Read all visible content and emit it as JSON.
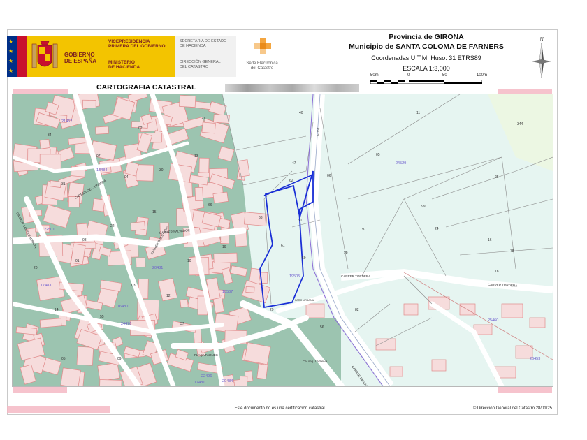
{
  "header": {
    "gov_line1": "GOBIERNO",
    "gov_line2": "DE ESPAÑA",
    "vice_line1": "VICEPRESIDENCIA",
    "vice_line2": "PRIMERA DEL GOBIERNO",
    "min_line1": "MINISTERIO",
    "min_line2": "DE HACIENDA",
    "sec_line1": "SECRETARÍA DE ESTADO",
    "sec_line2": "DE HACIENDA",
    "dgc_line1": "DIRECCIÓN GENERAL",
    "dgc_line2": "DEL CATASTRO",
    "sede_line1": "Sede Electrónica",
    "sede_line2": "del Catastro",
    "province": "Provincia de GIRONA",
    "municipality": "Municipio de SANTA COLOMA DE FARNERS",
    "coordinates": "Coordenadas U.T.M. Huso: 31 ETRS89",
    "scale": "ESCALA 1:3,000",
    "scalebar_labels": [
      "50m",
      "0",
      "50",
      "100m"
    ],
    "north_label": "N",
    "title": "CARTOGRAFIA CATASTRAL"
  },
  "colors": {
    "parcel_fill": "#e6f5f1",
    "built_fill": "#8ab8a2",
    "building_fill": "#f6dcdc",
    "building_stroke": "#e08a8a",
    "road_fill": "#ffffff",
    "highlight_stroke": "#1a2fd6",
    "label_blue": "#6a5acd"
  },
  "map": {
    "road_labels": [
      "CARRER TORDERA",
      "CARRER TORDERA",
      "CARRER SANTA BARBARA",
      "CARRER DE LA RIBERA",
      "PLAÇA FARNES",
      "C-152",
      "CARRER DE CALDES",
      "Cal seg. La Selva",
      "CARRER DEL CARME",
      "CARRER SALVADOR"
    ],
    "parcel_numbers": [
      "40",
      "21",
      "11",
      "344",
      "47",
      "05",
      "06",
      "25",
      "62",
      "99",
      "24",
      "01",
      "63",
      "60",
      "97",
      "18",
      "61",
      "98",
      "16",
      "59",
      "78",
      "29",
      "56",
      "82",
      "55",
      "03",
      "05",
      "12",
      "20",
      "10",
      "15",
      "22",
      "08",
      "14",
      "37",
      "19",
      "66",
      "09",
      "04",
      "07",
      "34",
      "02",
      "13",
      "30",
      "31"
    ],
    "block_codes": [
      "24529",
      "22501",
      "20481",
      "19505",
      "18507",
      "21462",
      "17483",
      "16480",
      "25460",
      "26453",
      "18484",
      "17481",
      "24476",
      "22496",
      "20484"
    ],
    "small_labels": [
      "PARC URBANA"
    ]
  },
  "footer": {
    "note": "Este documento no es una certificación catastral",
    "copyright": "© Dirección General del Catastro 28/01/25"
  }
}
